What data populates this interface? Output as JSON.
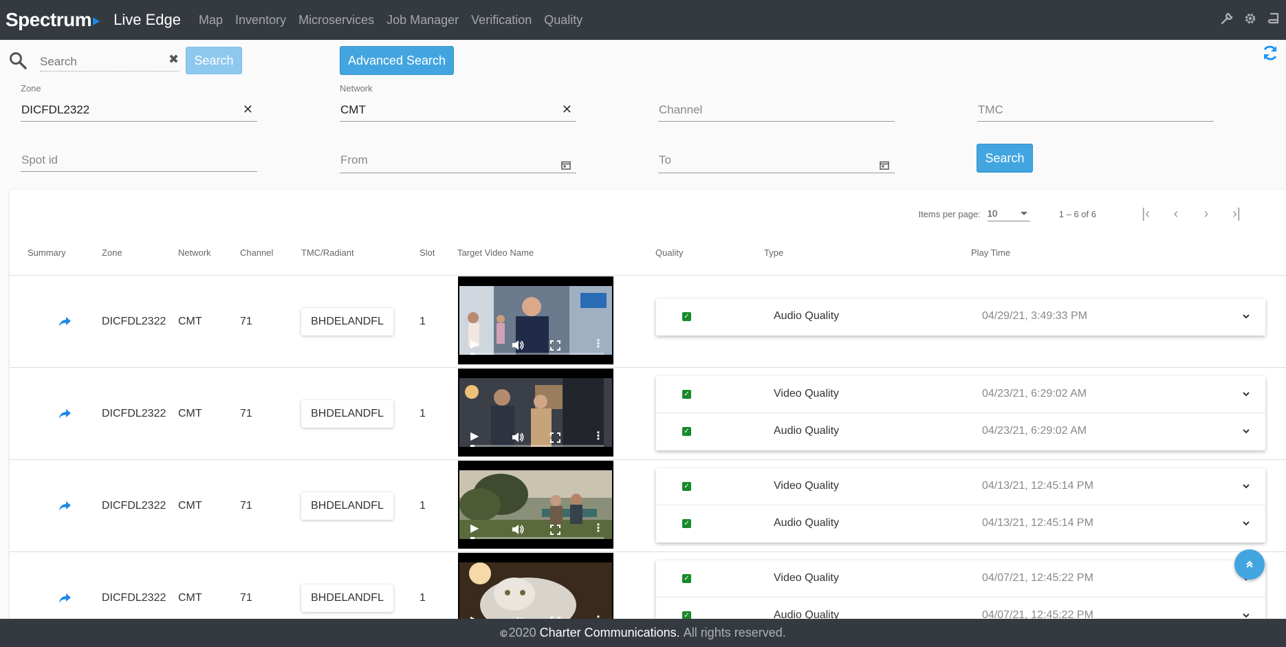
{
  "nav": {
    "brand": "Spectrum",
    "app_title": "Live Edge",
    "links": [
      "Map",
      "Inventory",
      "Microservices",
      "Job Manager",
      "Verification",
      "Quality"
    ],
    "icons": [
      "wrench-icon",
      "gear-icon",
      "book-icon"
    ]
  },
  "quick_search": {
    "placeholder": "Search",
    "button": "Search",
    "advanced_button": "Advanced Search"
  },
  "filters": {
    "zone": {
      "label": "Zone",
      "value": "DICFDL2322"
    },
    "network": {
      "label": "Network",
      "value": "CMT"
    },
    "channel": {
      "placeholder": "Channel"
    },
    "tmc": {
      "placeholder": "TMC"
    },
    "spot_id": {
      "placeholder": "Spot id"
    },
    "from": {
      "placeholder": "From"
    },
    "to": {
      "placeholder": "To"
    },
    "search_button": "Search"
  },
  "paginator": {
    "items_per_page_label": "Items per page:",
    "items_per_page": "10",
    "range": "1 – 6 of 6"
  },
  "table": {
    "headers": {
      "summary": "Summary",
      "zone": "Zone",
      "network": "Network",
      "channel": "Channel",
      "tmc": "TMC/Radiant",
      "slot": "Slot",
      "video": "Target Video Name",
      "quality": "Quality",
      "type": "Type",
      "play_time": "Play Time"
    },
    "rows": [
      {
        "zone": "DICFDL2322",
        "network": "CMT",
        "channel": "71",
        "tmc": "BHDELANDFL",
        "slot": "1",
        "qualities": [
          {
            "type": "Audio Quality",
            "time": "04/29/21, 3:49:33 PM"
          }
        ]
      },
      {
        "zone": "DICFDL2322",
        "network": "CMT",
        "channel": "71",
        "tmc": "BHDELANDFL",
        "slot": "1",
        "qualities": [
          {
            "type": "Video Quality",
            "time": "04/23/21, 6:29:02 AM"
          },
          {
            "type": "Audio Quality",
            "time": "04/23/21, 6:29:02 AM"
          }
        ]
      },
      {
        "zone": "DICFDL2322",
        "network": "CMT",
        "channel": "71",
        "tmc": "BHDELANDFL",
        "slot": "1",
        "qualities": [
          {
            "type": "Video Quality",
            "time": "04/13/21, 12:45:14 PM"
          },
          {
            "type": "Audio Quality",
            "time": "04/13/21, 12:45:14 PM"
          }
        ]
      },
      {
        "zone": "DICFDL2322",
        "network": "CMT",
        "channel": "71",
        "tmc": "BHDELANDFL",
        "slot": "1",
        "qualities": [
          {
            "type": "Video Quality",
            "time": "04/07/21, 12:45:22 PM"
          },
          {
            "type": "Audio Quality",
            "time": "04/07/21, 12:45:22 PM"
          }
        ]
      }
    ]
  },
  "footer": {
    "copyright": "©",
    "year": "2020",
    "company": "Charter Communications.",
    "rights": "All rights reserved."
  },
  "colors": {
    "nav_bg": "#343a40",
    "accent": "#42a5e0",
    "check_green": "#178a2a"
  }
}
